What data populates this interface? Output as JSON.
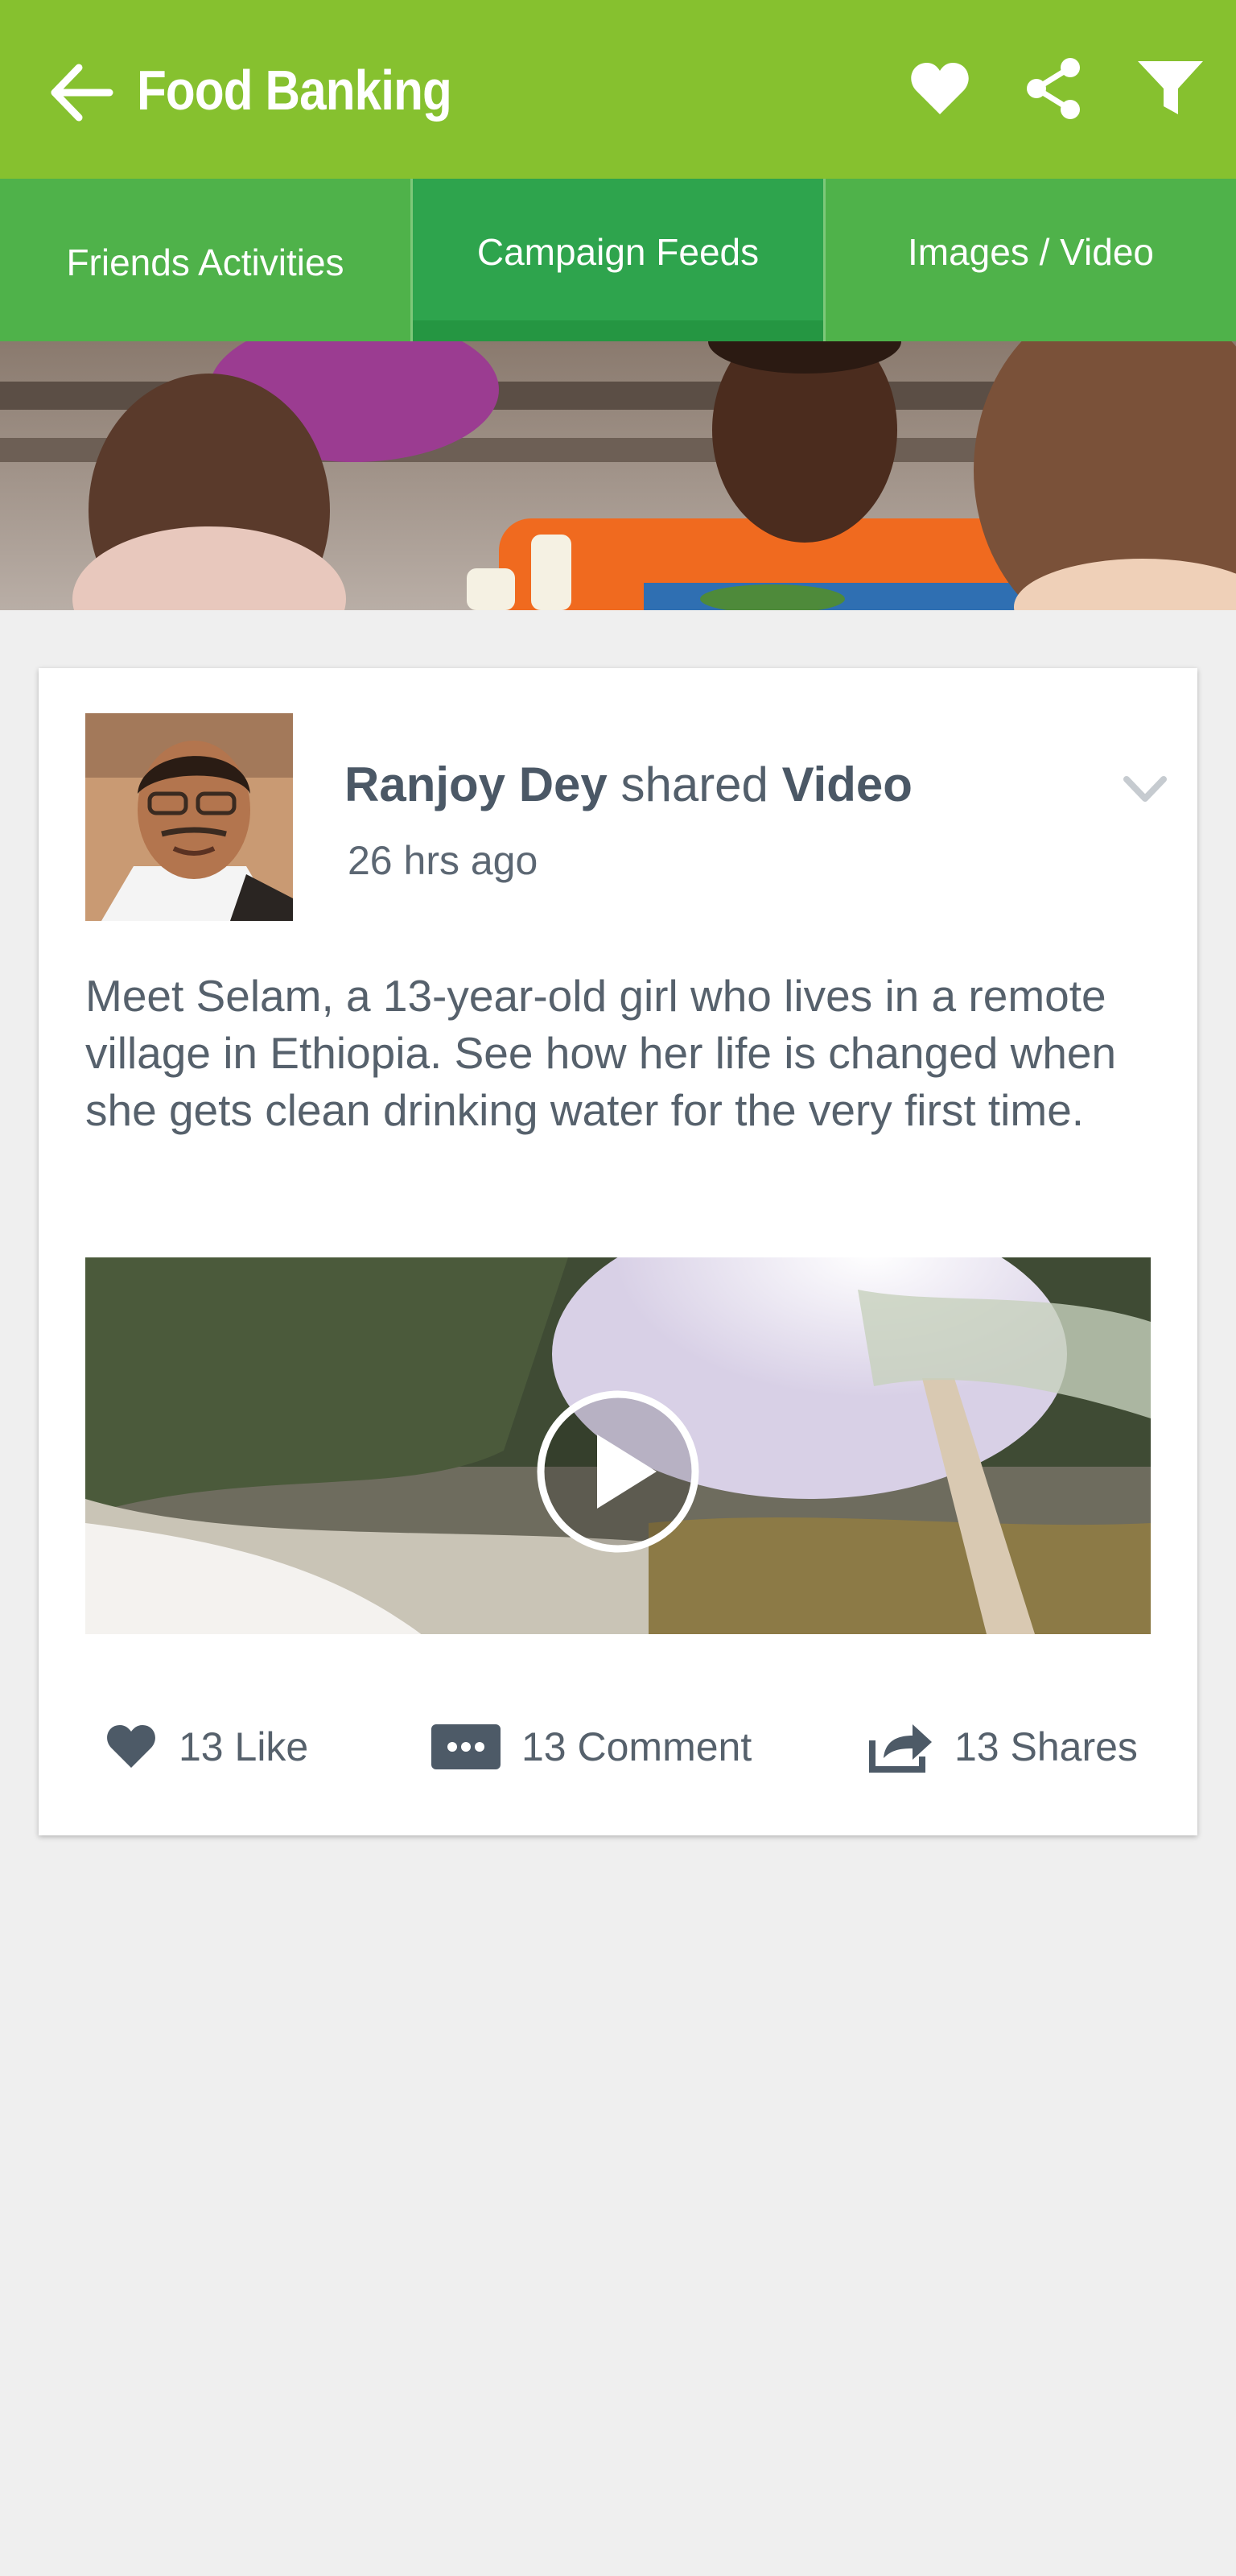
{
  "app_bar": {
    "title": "Food Banking",
    "back_icon": "arrow-left-icon",
    "icons": [
      "heart-icon",
      "share-icon",
      "filter-icon"
    ],
    "background": "#86c12f"
  },
  "tabs": [
    {
      "label": "Friends Activities",
      "active": false
    },
    {
      "label": "Campaign Feeds",
      "active": true
    },
    {
      "label": "Images / Video",
      "active": false
    }
  ],
  "post": {
    "author": "Ranjoy Dey",
    "verb": "shared",
    "object": "Video",
    "time": "26 hrs ago",
    "text": "Meet Selam, a 13-year-old girl who lives in a remote village in Ethiopia. See how her life is changed when she gets clean drinking water for the very first time.",
    "actions": {
      "like": "13 Like",
      "comment": "13 Comment",
      "share": "13 Shares"
    }
  },
  "colors": {
    "primary_green": "#86c12f",
    "tab_green": "#4fb24a",
    "active_tab": "#2ea44d",
    "text": "#56616c",
    "background": "#efefef"
  }
}
